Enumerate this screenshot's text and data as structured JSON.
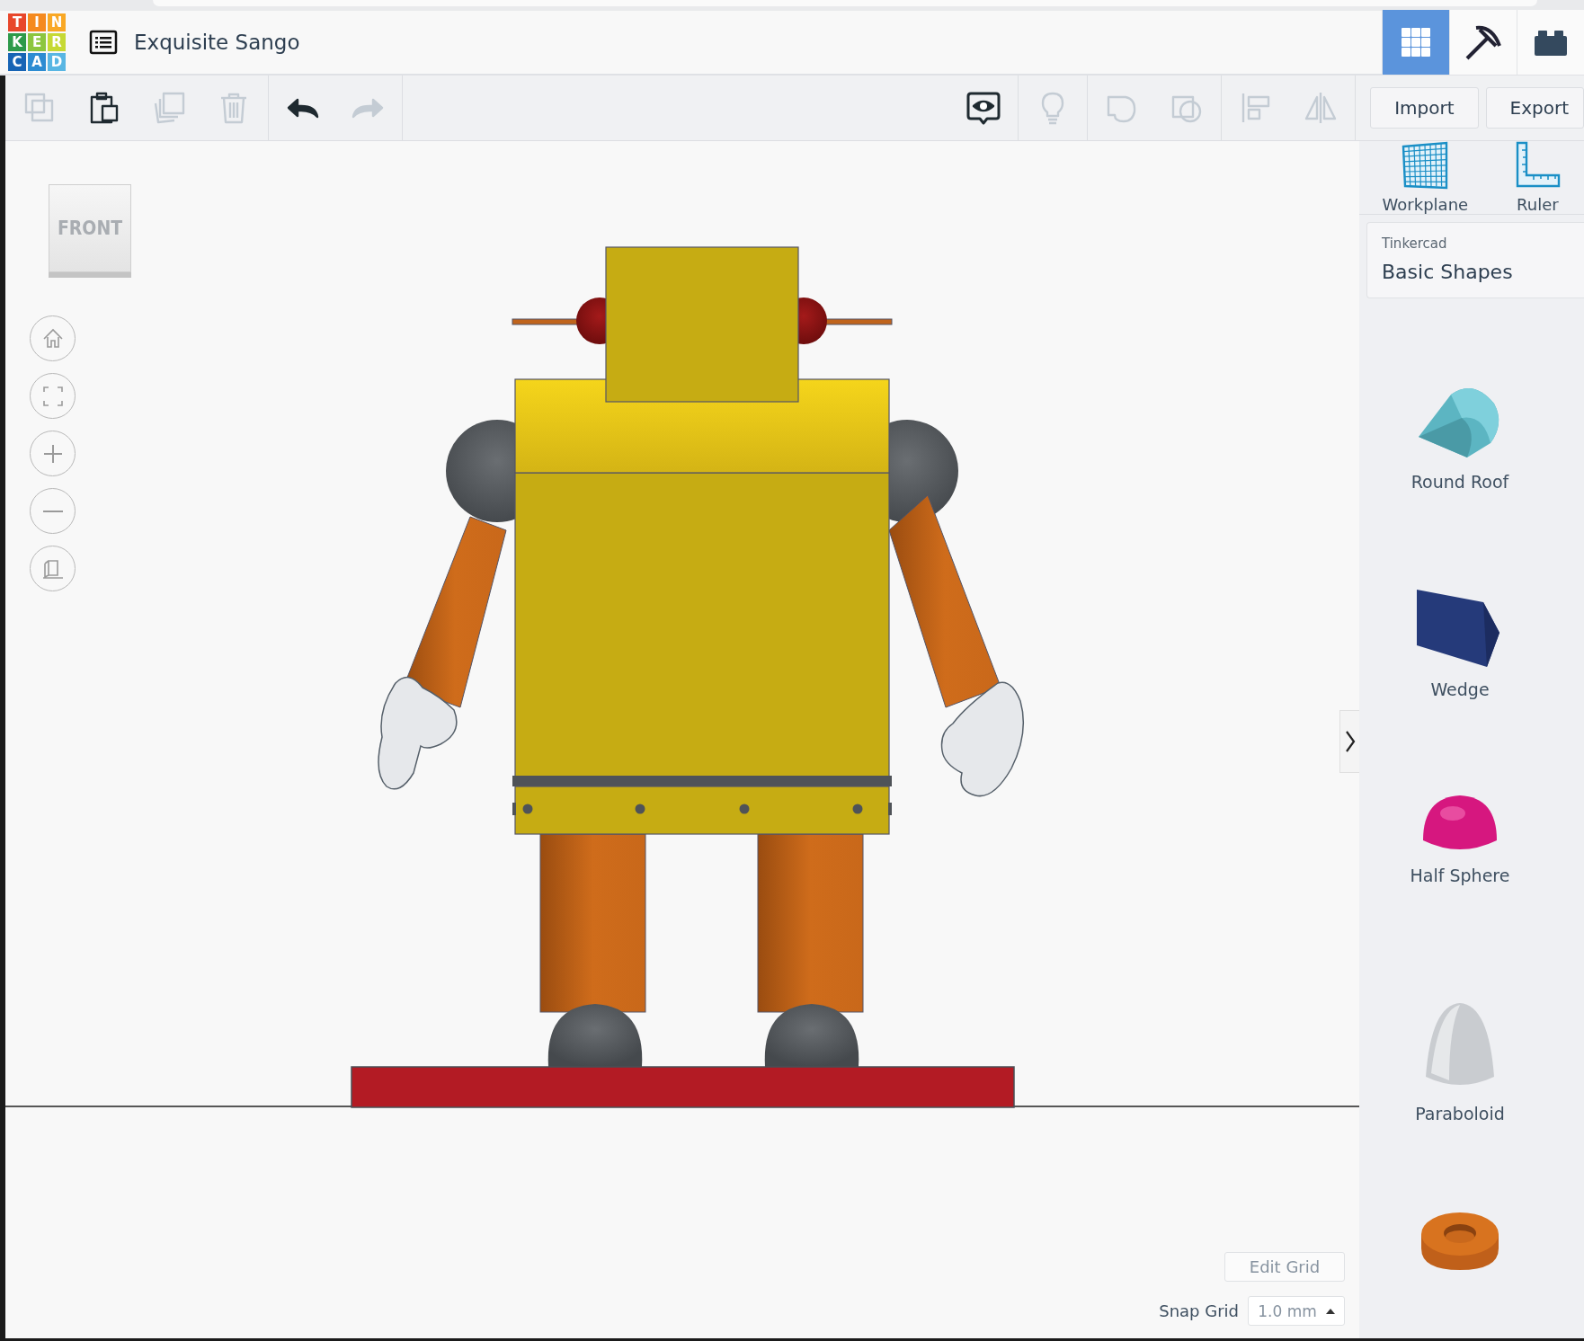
{
  "header": {
    "logo_letters": [
      "T",
      "I",
      "N",
      "K",
      "E",
      "R",
      "C",
      "A",
      "D"
    ],
    "title": "Exquisite Sango",
    "view_modes": [
      {
        "kind": "grid",
        "selected": true
      },
      {
        "kind": "blocks",
        "selected": false
      },
      {
        "kind": "bricks",
        "selected": false
      }
    ]
  },
  "toolbar": {
    "left_groups": [
      [
        {
          "kind": "copy",
          "disabled": true
        },
        {
          "kind": "paste",
          "disabled": false
        },
        {
          "kind": "duplicate",
          "disabled": true
        },
        {
          "kind": "delete",
          "disabled": true
        }
      ],
      [
        {
          "kind": "undo",
          "disabled": false
        },
        {
          "kind": "redo",
          "disabled": true
        }
      ]
    ],
    "right_groups": [
      [
        {
          "kind": "notes",
          "disabled": false
        }
      ],
      [
        {
          "kind": "bulb",
          "disabled": true
        }
      ],
      [
        {
          "kind": "group",
          "disabled": true
        },
        {
          "kind": "ungroup",
          "disabled": true
        }
      ],
      [
        {
          "kind": "align",
          "disabled": true
        },
        {
          "kind": "mirror",
          "disabled": true
        }
      ]
    ],
    "buttons": [
      "Import",
      "Export"
    ]
  },
  "view_cube": {
    "label": "FRONT"
  },
  "nav_controls": [
    {
      "kind": "home"
    },
    {
      "kind": "fit"
    },
    {
      "kind": "zoomin"
    },
    {
      "kind": "zoomout"
    },
    {
      "kind": "perspective"
    }
  ],
  "panel": {
    "tools": [
      {
        "kind": "workplane",
        "label": "Workplane"
      },
      {
        "kind": "ruler",
        "label": "Ruler"
      }
    ],
    "library": {
      "source": "Tinkercad",
      "name": "Basic Shapes"
    },
    "shapes": [
      {
        "kind": "round-roof",
        "label": "Round Roof"
      },
      {
        "kind": "wedge",
        "label": "Wedge"
      },
      {
        "kind": "half-sphere",
        "label": "Half Sphere"
      },
      {
        "kind": "paraboloid",
        "label": "Paraboloid"
      },
      {
        "kind": "torus"
      }
    ]
  },
  "grid": {
    "edit_button": "Edit Grid",
    "snap_label": "Snap Grid",
    "snap_value": "1.0 mm"
  }
}
